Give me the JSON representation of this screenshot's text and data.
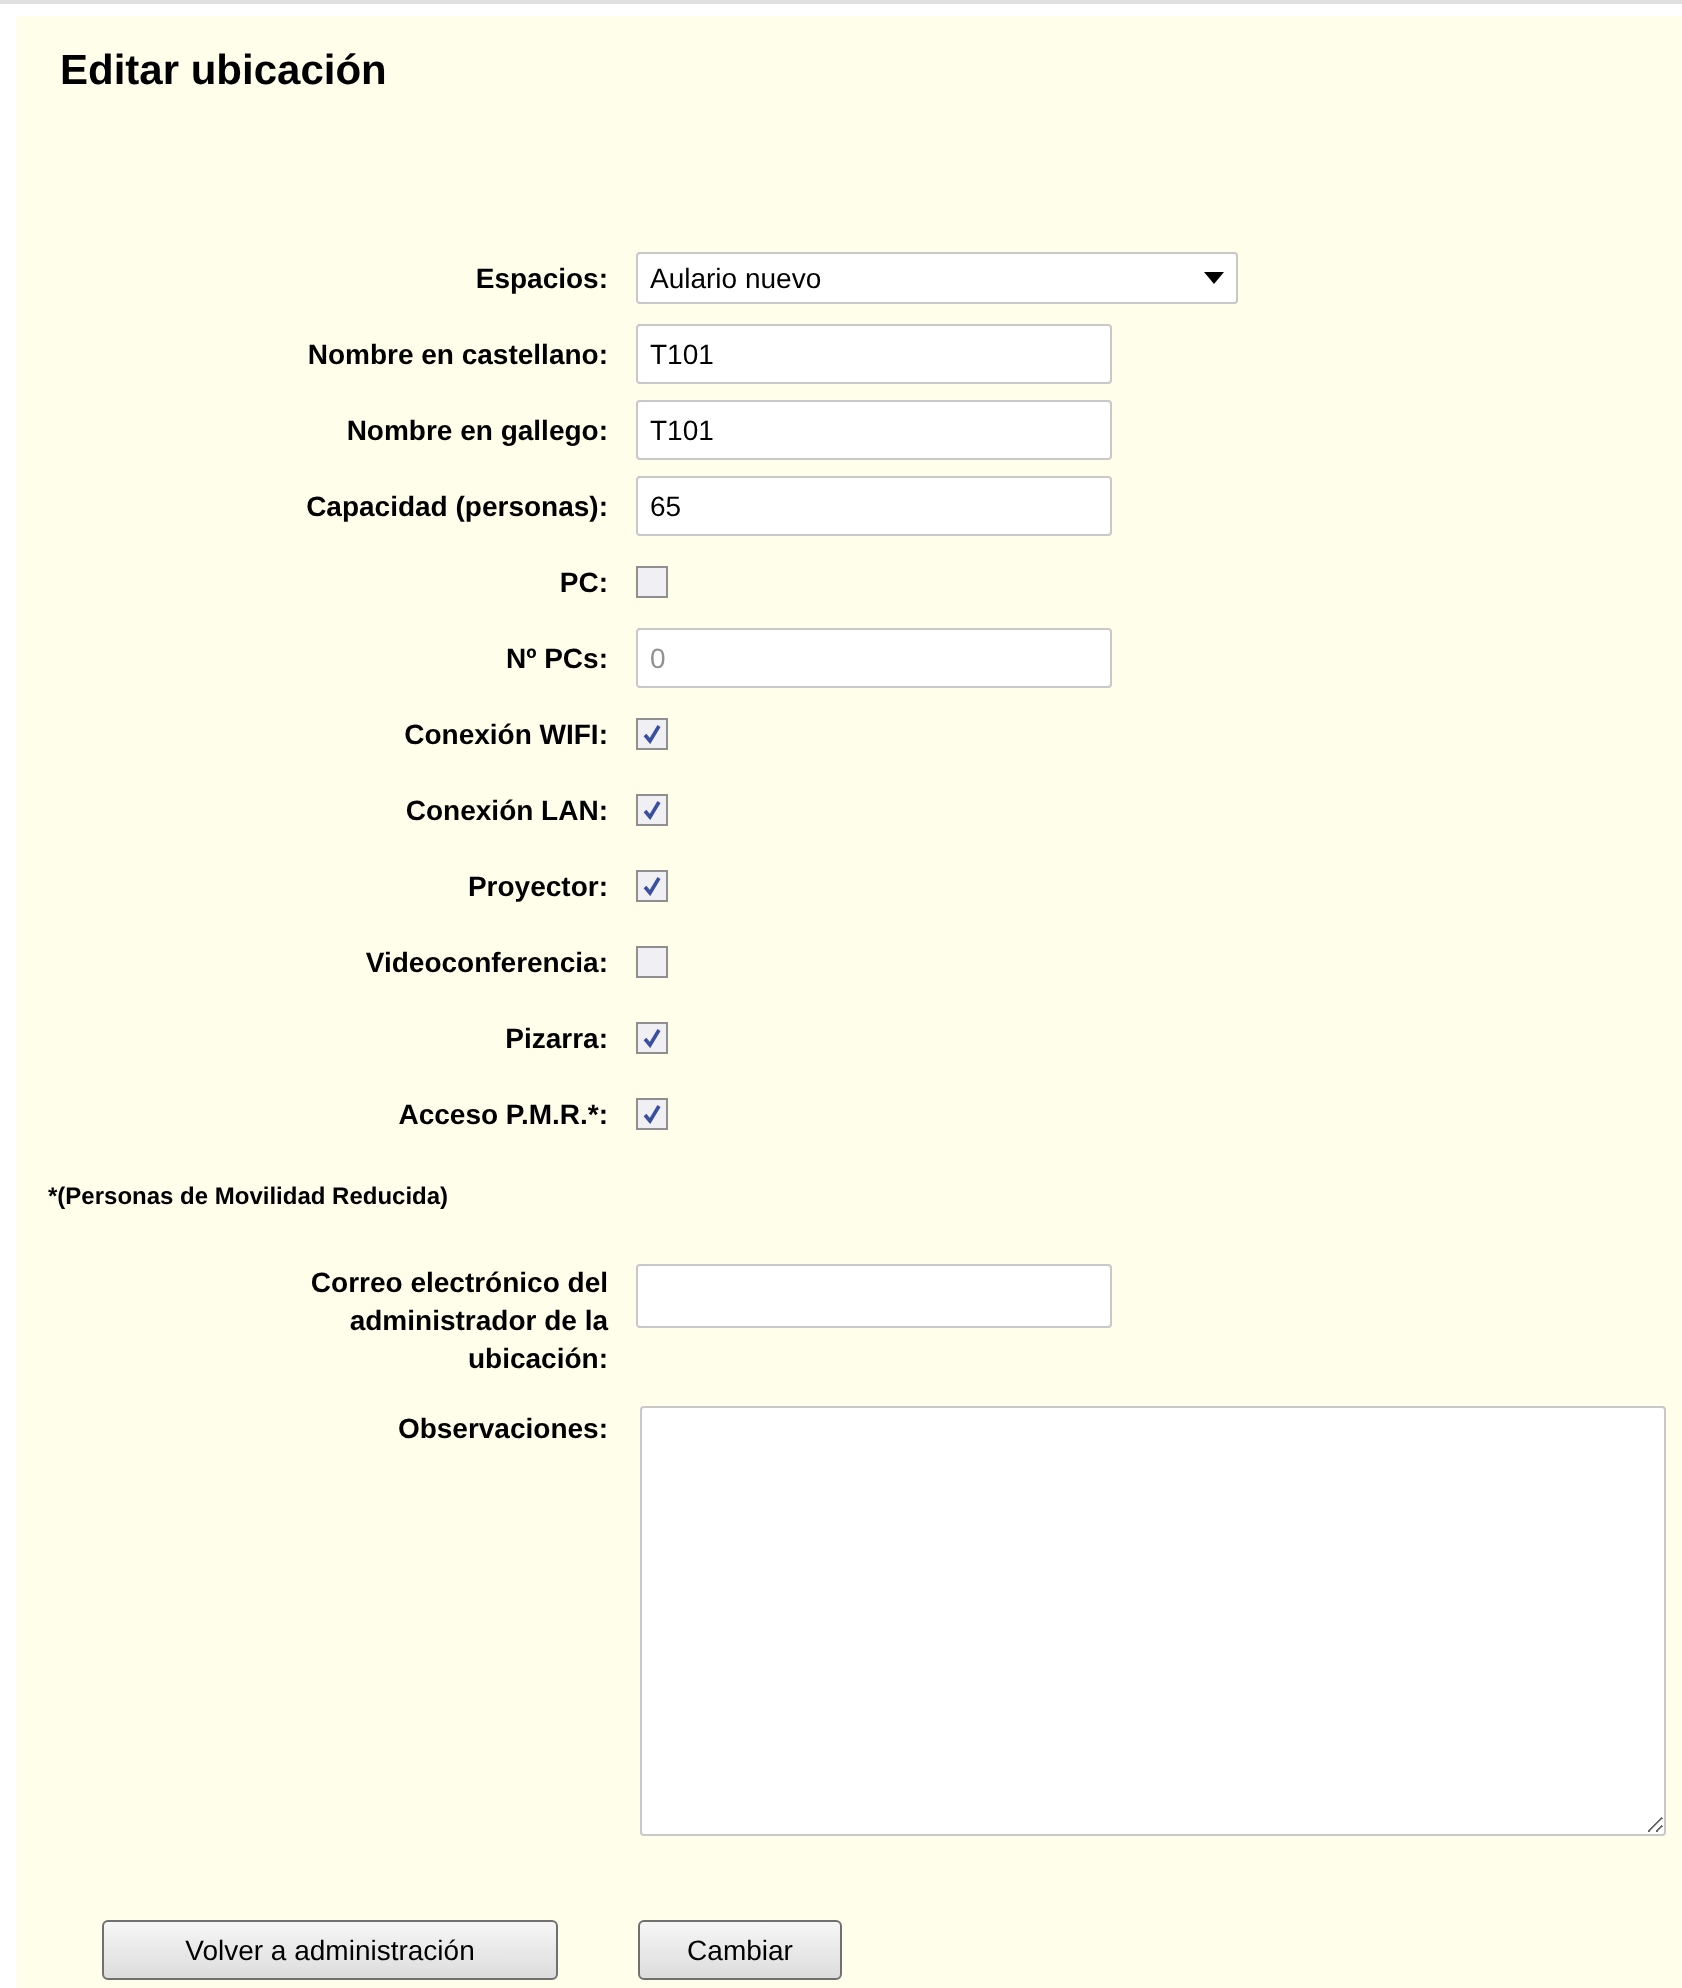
{
  "title": "Editar ubicación",
  "fields": [
    {
      "kind": "select",
      "label": "Espacios:",
      "value": "Aulario nuevo"
    },
    {
      "kind": "text",
      "label": "Nombre en castellano:",
      "value": "T101",
      "disabled": false
    },
    {
      "kind": "text",
      "label": "Nombre en gallego:",
      "value": "T101",
      "disabled": false
    },
    {
      "kind": "text",
      "label": "Capacidad (personas):",
      "value": "65",
      "disabled": false
    },
    {
      "kind": "checkbox",
      "label": "PC:",
      "checked": false
    },
    {
      "kind": "text",
      "label": "Nº PCs:",
      "value": "0",
      "disabled": true
    },
    {
      "kind": "checkbox",
      "label": "Conexión WIFI:",
      "checked": true
    },
    {
      "kind": "checkbox",
      "label": "Conexión LAN:",
      "checked": true
    },
    {
      "kind": "checkbox",
      "label": "Proyector:",
      "checked": true
    },
    {
      "kind": "checkbox",
      "label": "Videoconferencia:",
      "checked": false
    },
    {
      "kind": "checkbox",
      "label": "Pizarra:",
      "checked": true
    },
    {
      "kind": "checkbox",
      "label": "Acceso P.M.R.*:",
      "checked": true
    }
  ],
  "footnote": "*(Personas de Movilidad Reducida)",
  "email": {
    "label": "Correo electrónico del administrador de la ubicación:"
  },
  "notes": {
    "label": "Observaciones:"
  },
  "buttons": [
    "Volver a administración",
    "Cambiar"
  ]
}
